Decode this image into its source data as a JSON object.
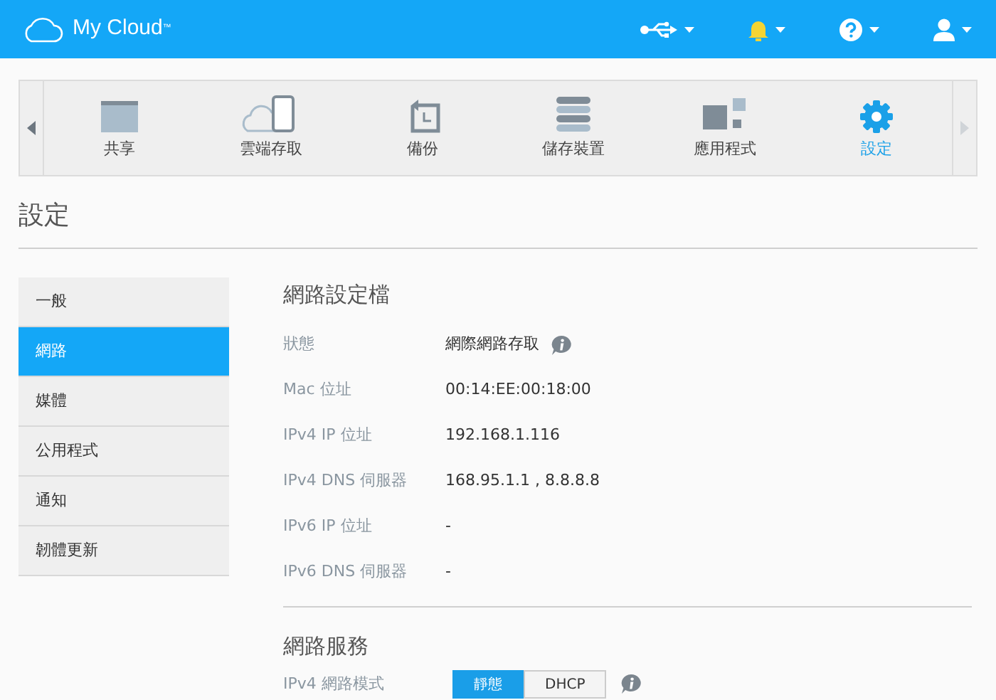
{
  "header": {
    "logo_text": "My Cloud",
    "logo_mark": "™"
  },
  "nav": {
    "items": [
      {
        "label": "共享",
        "kind": "folder",
        "selected": false
      },
      {
        "label": "雲端存取",
        "kind": "cloud",
        "selected": false
      },
      {
        "label": "備份",
        "kind": "backup",
        "selected": false
      },
      {
        "label": "儲存裝置",
        "kind": "storage",
        "selected": false
      },
      {
        "label": "應用程式",
        "kind": "apps",
        "selected": false
      },
      {
        "label": "設定",
        "kind": "gear",
        "selected": true
      }
    ]
  },
  "page_title": "設定",
  "sidebar": {
    "items": [
      {
        "label": "一般",
        "selected": false
      },
      {
        "label": "網路",
        "selected": true
      },
      {
        "label": "媒體",
        "selected": false
      },
      {
        "label": "公用程式",
        "selected": false
      },
      {
        "label": "通知",
        "selected": false
      },
      {
        "label": "韌體更新",
        "selected": false
      }
    ]
  },
  "profile": {
    "title": "網路設定檔",
    "rows": [
      {
        "label": "狀態",
        "value": "網際網路存取",
        "info": true
      },
      {
        "label": "Mac 位址",
        "value": "00:14:EE:00:18:00",
        "info": false
      },
      {
        "label": "IPv4 IP 位址",
        "value": "192.168.1.116",
        "info": false
      },
      {
        "label": "IPv4 DNS 伺服器",
        "value": "168.95.1.1 , 8.8.8.8",
        "info": false
      },
      {
        "label": "IPv6 IP 位址",
        "value": "-",
        "info": false
      },
      {
        "label": "IPv6 DNS 伺服器",
        "value": "-",
        "info": false
      }
    ]
  },
  "services": {
    "title": "網路服務",
    "mode": {
      "label": "IPv4 網路模式",
      "options": [
        {
          "label": "靜態",
          "selected": true
        },
        {
          "label": "DHCP",
          "selected": false
        }
      ],
      "info": true
    }
  }
}
